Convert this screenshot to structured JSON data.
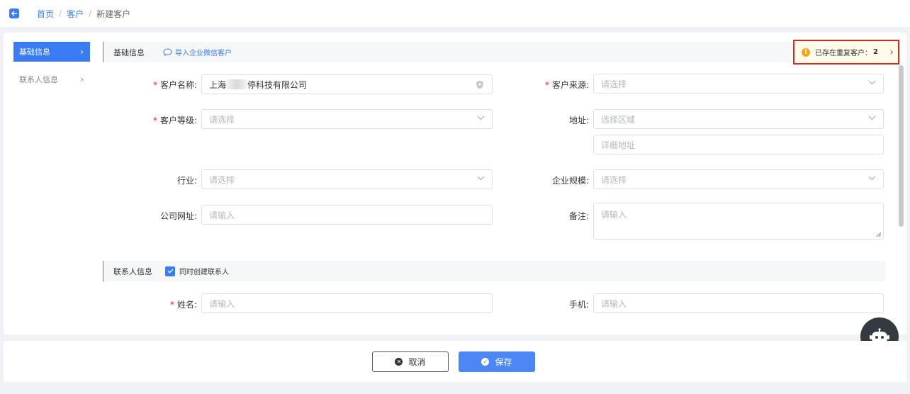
{
  "breadcrumb": {
    "home": "首页",
    "customers": "客户",
    "current": "新建客户",
    "separator": "/"
  },
  "nav": {
    "basic": "基础信息",
    "contact": "联系人信息"
  },
  "sections": {
    "basic_title": "基础信息",
    "import_wecom": "导入企业微信客户",
    "contact_title": "联系人信息",
    "create_contact_label": "同时创建联系人"
  },
  "duplicate": {
    "text": "已存在重复客户：",
    "count": "2"
  },
  "form": {
    "name_label": "客户名称:",
    "name_value_start": "上海",
    "name_value_end": "停科技有限公司",
    "source_label": "客户来源:",
    "source_placeholder": "请选择",
    "level_label": "客户等级:",
    "level_placeholder": "请选择",
    "address_label": "地址:",
    "region_placeholder": "选择区域",
    "detail_placeholder": "详细地址",
    "industry_label": "行业:",
    "industry_placeholder": "请选择",
    "scale_label": "企业规模:",
    "scale_placeholder": "请选择",
    "website_label": "公司网址:",
    "website_placeholder": "请输入",
    "remark_label": "备注:",
    "remark_placeholder": "请输入",
    "contact_name_label": "姓名:",
    "contact_name_placeholder": "请输入",
    "mobile_label": "手机:",
    "mobile_placeholder": "请输入",
    "required_mark": "*"
  },
  "actions": {
    "cancel": "取消",
    "save": "保存"
  },
  "colors": {
    "primary": "#3a7bf6",
    "danger": "#e0251b",
    "warning": "#f7a21b"
  },
  "icons": {
    "back": "back-arrow-icon",
    "robot": "robot-icon",
    "chevron": "chevron-down-icon"
  }
}
